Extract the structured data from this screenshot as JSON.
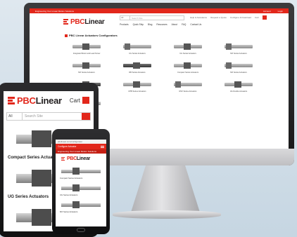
{
  "desktop": {
    "topbar_left": "Engineering Your Linear Motion Solutions",
    "topbar_links": [
      "Account",
      "Login"
    ],
    "logo": {
      "prefix": "PBC",
      "suffix": "Linear"
    },
    "search": {
      "category": "All",
      "placeholder": "Search Site"
    },
    "header_links": [
      "Help & Assistance",
      "Request a Quote",
      "Configure & Download",
      "Cart"
    ],
    "nav": [
      "Products",
      "Quick Ship",
      "Blog",
      "Resources",
      "About",
      "FAQ",
      "Contact Us"
    ],
    "section_title": "PBC Linear Actuators Configurators",
    "cards": [
      "Integrated Motor and Lead Screw",
      "UG Series Actuators",
      "UG Series Actuators",
      "MX Series Actuators",
      "MX Series Actuators",
      "RB Series Actuators",
      "Compact Series Actuators",
      "MX Series Actuators",
      "MX Series Actuators",
      "MTB Series Actuators",
      "RSX Series Actuators",
      "UG Double Actuators",
      "Linear Slide Actuators"
    ]
  },
  "tablet": {
    "logo": {
      "prefix": "PBC",
      "suffix": "Linear"
    },
    "cart_label": "Cart",
    "search": {
      "category": "All",
      "placeholder": "Search Site"
    },
    "captions": [
      "Compact Series Actuators",
      "UG Series Actuators"
    ]
  },
  "phone": {
    "status": "pbclinear.com/configurator",
    "bar_title": "Configure Actuator",
    "sub_bar": "Engineering Your Linear Motion Solutions",
    "logo": {
      "prefix": "PBC",
      "suffix": "Linear"
    },
    "captions": [
      "Compact Series Actuators",
      "UG Series Actuators",
      "MX Series Actuators"
    ]
  }
}
